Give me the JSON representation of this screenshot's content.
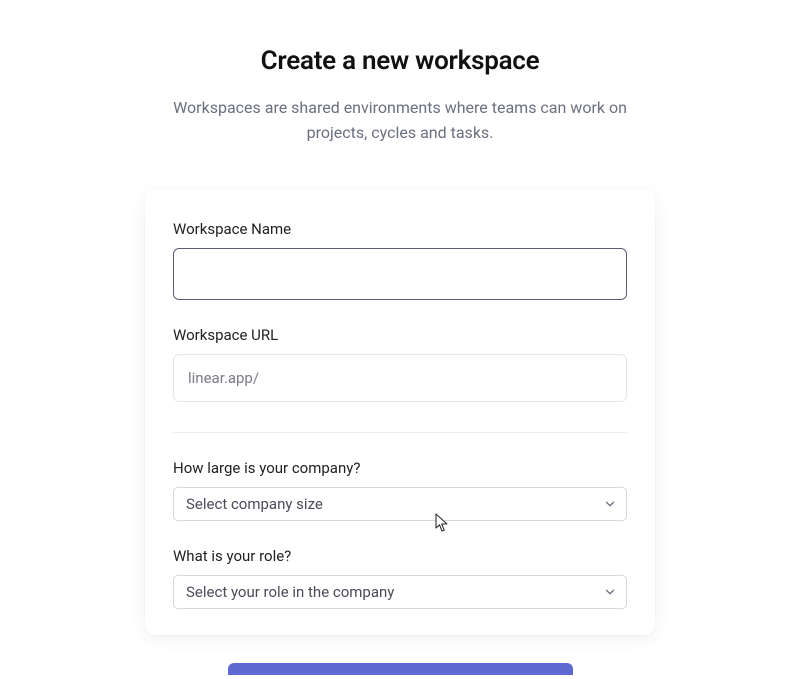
{
  "header": {
    "title": "Create a new workspace",
    "subtitle": "Workspaces are shared environments where teams can work on projects, cycles and tasks."
  },
  "form": {
    "workspace_name": {
      "label": "Workspace Name",
      "value": ""
    },
    "workspace_url": {
      "label": "Workspace URL",
      "prefix": "linear.app/"
    },
    "company_size": {
      "label": "How large is your company?",
      "placeholder": "Select company size"
    },
    "role": {
      "label": "What is your role?",
      "placeholder": "Select your role in the company"
    }
  },
  "colors": {
    "accent": "#5e6ad2"
  }
}
